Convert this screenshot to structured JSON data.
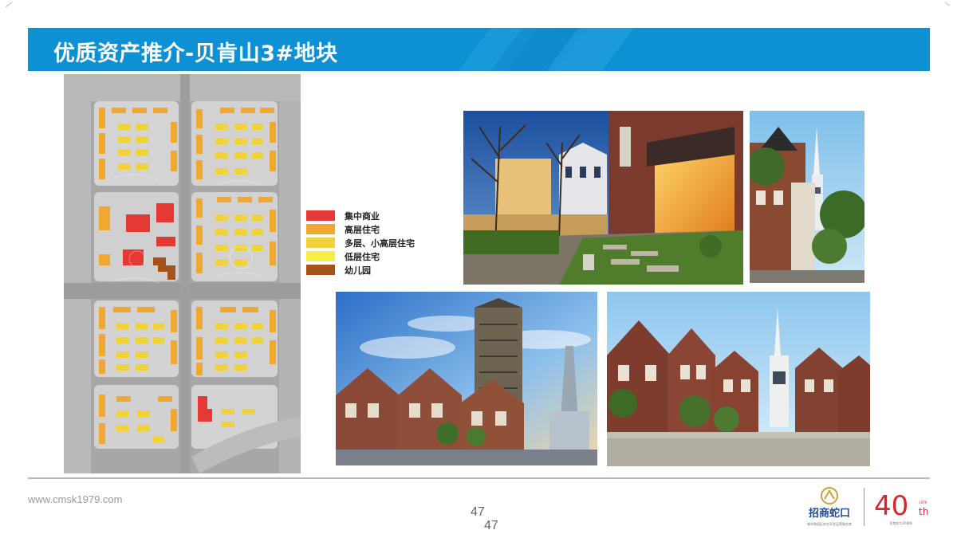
{
  "header": {
    "title": "优质资产推介-贝肯山3#地块"
  },
  "legend": {
    "items": [
      {
        "label": "集中商业",
        "color": "#e53935"
      },
      {
        "label": "高层住宅",
        "color": "#f0a830"
      },
      {
        "label": "多层、小高层住宅",
        "color": "#f0d23a"
      },
      {
        "label": "低层住宅",
        "color": "#f7ee45"
      },
      {
        "label": "幼儿园",
        "color": "#a6521a"
      }
    ]
  },
  "footer": {
    "url": "www.cmsk1979.com",
    "page_number": "47",
    "page_number_dup": "47"
  },
  "branding": {
    "company_name": "招商蛇口",
    "company_subtitle": "城市和园区综合开发运营服务商",
    "anniversary_number": "40",
    "anniversary_suffix": "th",
    "anniversary_small": "1979",
    "anniversary_caption": "招商蛇口40周年",
    "accent_color": "#d9232d",
    "brand_blue": "#0e91d4"
  }
}
